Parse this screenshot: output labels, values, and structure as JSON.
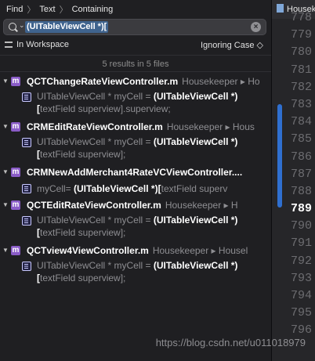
{
  "breadcrumb": {
    "items": [
      "Find",
      "Text",
      "Containing"
    ]
  },
  "search": {
    "value": "(UITableViewCell *)["
  },
  "scope": {
    "label": "In Workspace",
    "case_label": "Ignoring Case ◇"
  },
  "summary": "5 results in 5 files",
  "results": [
    {
      "file": "QCTChangeRateViewController.m",
      "path": "Housekeeper ▸ Ho",
      "pre": "UITableViewCell * myCell = ",
      "hl": "(UITableViewCell *)[",
      "post": "textField superview].superview;"
    },
    {
      "file": "CRMEditRateViewController.m",
      "path": "Housekeeper ▸ Hous",
      "pre": "UITableViewCell * myCell = ",
      "hl": "(UITableViewCell *)[",
      "post": "textField superview];"
    },
    {
      "file": "CRMNewAddMerchant4RateVCViewController....",
      "path": "",
      "pre": "myCell= ",
      "hl": "(UITableViewCell *)[",
      "post": "textField superv"
    },
    {
      "file": "QCTEditRateViewController.m",
      "path": "Housekeeper ▸ H",
      "pre": "UITableViewCell * myCell = ",
      "hl": "(UITableViewCell *)[",
      "post": "textField superview];"
    },
    {
      "file": "QCTview4ViewController.m",
      "path": "Housekeeper ▸ Housel",
      "pre": "UITableViewCell * myCell = ",
      "hl": "(UITableViewCell *)[",
      "post": "textField superview];"
    }
  ],
  "editor": {
    "tab_label": "Housek",
    "line_numbers": [
      "778",
      "779",
      "780",
      "781",
      "782",
      "783",
      "784",
      "785",
      "786",
      "787",
      "788",
      "789",
      "790",
      "791",
      "792",
      "793",
      "794",
      "795",
      "796"
    ],
    "current_line": "789"
  },
  "watermark": "https://blog.csdn.net/u011018979"
}
